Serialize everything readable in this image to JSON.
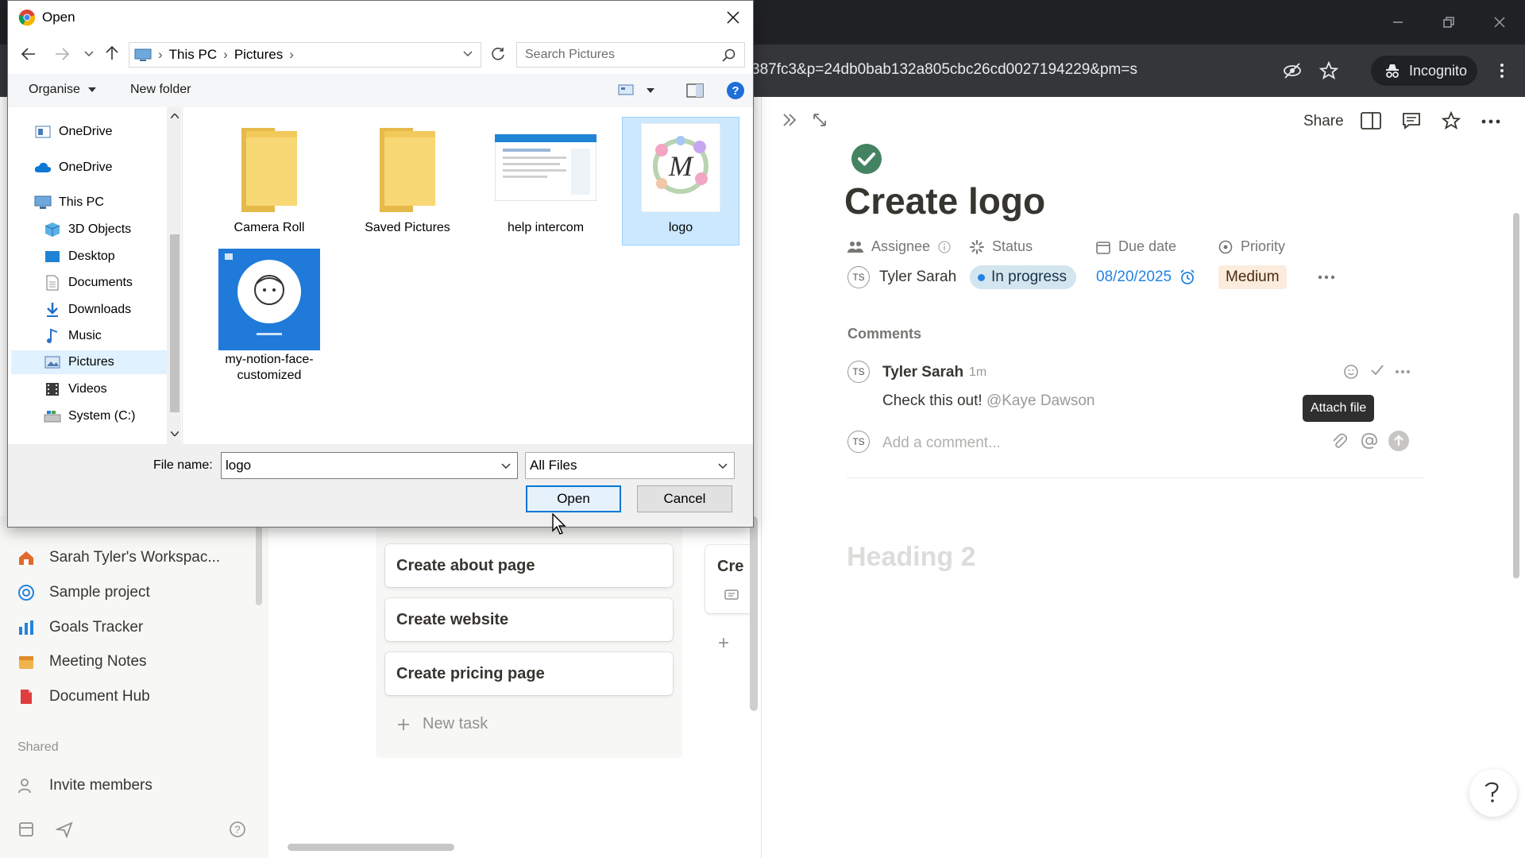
{
  "browser": {
    "url": "387fc3&p=24db0bab132a805cbc26cd0027194229&pm=s",
    "incognito_label": "Incognito"
  },
  "sidebar": {
    "workspace": "Sarah Tyler's Workspac...",
    "items": [
      {
        "label": "Sample project",
        "icon": "target-icon"
      },
      {
        "label": "Goals Tracker",
        "icon": "chart-icon"
      },
      {
        "label": "Meeting Notes",
        "icon": "calendar-icon"
      },
      {
        "label": "Document Hub",
        "icon": "document-icon"
      }
    ],
    "shared_label": "Shared",
    "invite_label": "Invite members"
  },
  "board": {
    "cards": [
      "Create about page",
      "Create website",
      "Create pricing page"
    ],
    "new_task_label": "New task",
    "next_column_card": "Cre"
  },
  "panel": {
    "toolbar": {
      "share_label": "Share"
    },
    "title": "Create logo",
    "properties": {
      "assignee_label": "Assignee",
      "status_label": "Status",
      "due_label": "Due date",
      "priority_label": "Priority",
      "assignee_value": "Tyler Sarah",
      "status_value": "In progress",
      "due_value": "08/20/2025",
      "priority_value": "Medium"
    },
    "comments_label": "Comments",
    "comment": {
      "author": "Tyler Sarah",
      "time": "1m",
      "text": "Check this out!",
      "mention": "@Kaye Dawson"
    },
    "add_comment_placeholder": "Add a comment...",
    "tooltip": "Attach file",
    "heading_placeholder": "Heading 2",
    "colors": {
      "status_bg": "#d3e5ef",
      "priority_bg": "#fbecdd",
      "due_color": "#2383e2",
      "check_green": "#448361"
    }
  },
  "dialog": {
    "title": "Open",
    "breadcrumb": [
      "This PC",
      "Pictures"
    ],
    "search_placeholder": "Search Pictures",
    "organise_label": "Organise",
    "new_folder_label": "New folder",
    "tree": [
      {
        "label": "OneDrive",
        "icon": "onedrive-icon"
      },
      {
        "label": "OneDrive",
        "icon": "cloud-icon"
      },
      {
        "label": "This PC",
        "icon": "computer-icon"
      },
      {
        "label": "3D Objects",
        "icon": "cube-icon"
      },
      {
        "label": "Desktop",
        "icon": "desktop-icon"
      },
      {
        "label": "Documents",
        "icon": "documents-icon"
      },
      {
        "label": "Downloads",
        "icon": "download-icon"
      },
      {
        "label": "Music",
        "icon": "music-icon"
      },
      {
        "label": "Pictures",
        "icon": "pictures-icon"
      },
      {
        "label": "Videos",
        "icon": "videos-icon"
      },
      {
        "label": "System (C:)",
        "icon": "drive-icon"
      }
    ],
    "files": [
      {
        "name": "Camera Roll",
        "type": "folder"
      },
      {
        "name": "Saved Pictures",
        "type": "folder"
      },
      {
        "name": "help intercom",
        "type": "image"
      },
      {
        "name": "logo",
        "type": "image"
      },
      {
        "name": "my-notion-face-customized",
        "type": "image"
      }
    ],
    "file_name_label": "File name:",
    "file_name_value": "logo",
    "file_type_value": "All Files",
    "open_label": "Open",
    "cancel_label": "Cancel"
  }
}
